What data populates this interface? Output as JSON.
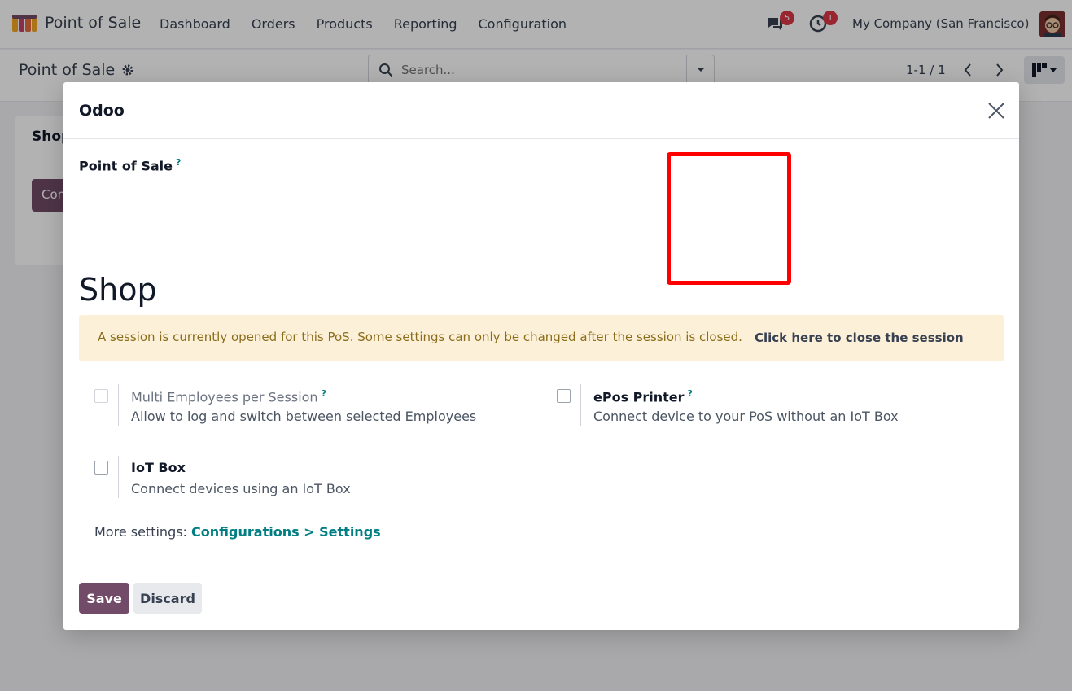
{
  "topnav": {
    "app_title": "Point of Sale",
    "menu": [
      "Dashboard",
      "Orders",
      "Products",
      "Reporting",
      "Configuration"
    ],
    "messages_count": "5",
    "activities_count": "1",
    "company": "My Company (San Francisco)"
  },
  "control": {
    "breadcrumb": "Point of Sale",
    "search_placeholder": "Search...",
    "pager": "1-1 / 1"
  },
  "background_card": {
    "title": "Shop",
    "button_label": "Continue Selling"
  },
  "modal": {
    "title": "Odoo",
    "field_label": "Point of Sale",
    "help_mark": "?",
    "record_name": "Shop",
    "alert_text": "A session is currently opened for this PoS. Some settings can only be changed after the session is closed.",
    "alert_link": "Click here to close the session",
    "settings": [
      {
        "title": "Multi Employees per Session",
        "description": "Allow to log and switch between selected Employees",
        "checked": false,
        "disabled": true
      },
      {
        "title": "ePos Printer",
        "description": "Connect device to your PoS without an IoT Box",
        "checked": false,
        "disabled": false
      },
      {
        "title": "IoT Box",
        "description": "Connect devices using an IoT Box",
        "checked": false,
        "disabled": false
      }
    ],
    "more_settings_label": "More settings:",
    "more_settings_link": "Configurations > Settings",
    "save_label": "Save",
    "discard_label": "Discard"
  },
  "colors": {
    "brand": "#714b67",
    "link": "#017e84",
    "alert_bg": "#fdf0d8",
    "highlight": "#ff0000"
  }
}
